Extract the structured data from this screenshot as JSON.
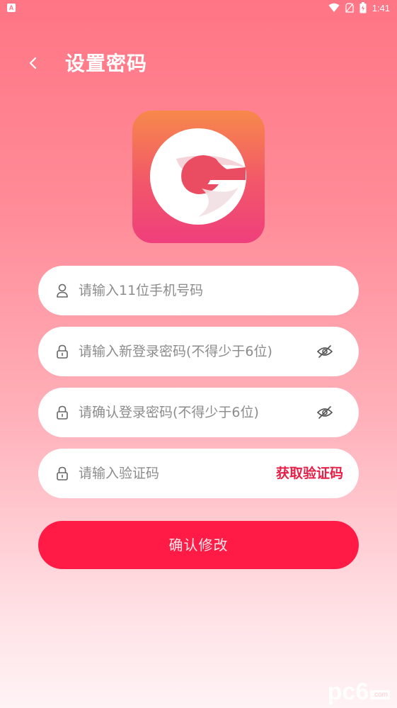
{
  "status_bar": {
    "left_badge": "A",
    "time": "1:41",
    "icons": [
      "wifi-icon",
      "no-sim-icon",
      "battery-icon"
    ]
  },
  "header": {
    "back_icon": "chevron-left-icon",
    "title": "设置密码"
  },
  "logo": {
    "icon": "app-logo-g"
  },
  "form": {
    "phone": {
      "icon": "user-icon",
      "placeholder": "请输入11位手机号码"
    },
    "new_password": {
      "icon": "lock-icon",
      "placeholder": "请输入新登录密码(不得少于6位)",
      "toggle_icon": "eye-off-icon"
    },
    "confirm_password": {
      "icon": "lock-icon",
      "placeholder": "请确认登录密码(不得少于6位)",
      "toggle_icon": "eye-off-icon"
    },
    "code": {
      "icon": "lock-icon",
      "placeholder": "请输入验证码",
      "get_code_label": "获取验证码"
    },
    "submit_label": "确认修改"
  },
  "watermark": {
    "text": "pc6",
    "suffix": ".com"
  },
  "colors": {
    "accent": "#ff1b46",
    "get_code": "#e81f47",
    "bg_top": "#ff7585",
    "bg_bottom": "#fff3f5"
  }
}
